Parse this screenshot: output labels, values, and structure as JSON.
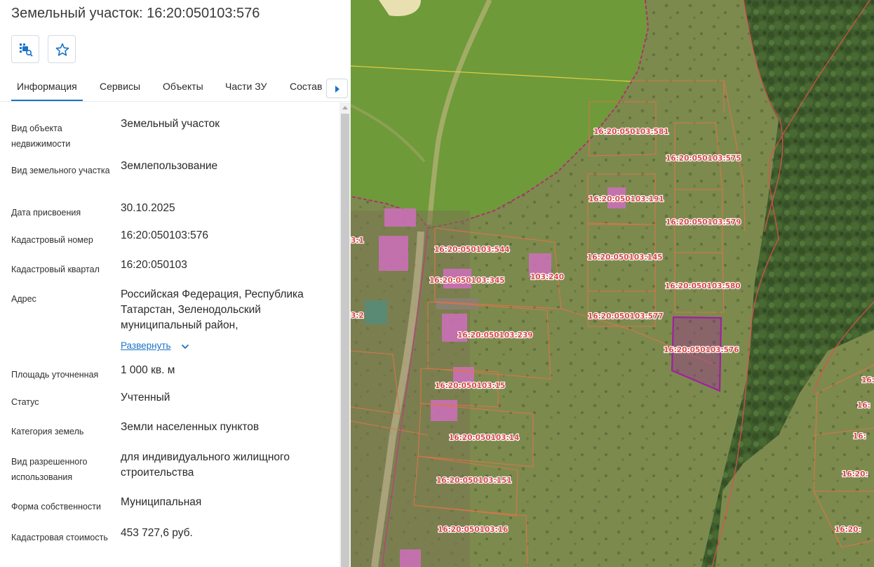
{
  "header": {
    "title": "Земельный участок: 16:20:050103:576",
    "buttons": [
      {
        "icon": "map-search-icon"
      },
      {
        "icon": "star-icon"
      }
    ]
  },
  "tabs": {
    "items": [
      "Информация",
      "Сервисы",
      "Объекты",
      "Части ЗУ",
      "Состав"
    ],
    "active": "Информация"
  },
  "info": {
    "object_type_label": "Вид объекта недвижимости",
    "object_type_value": "Земельный участок",
    "land_type_label": "Вид земельного участка",
    "land_type_value": "Землепользование",
    "assign_date_label": "Дата присвоения",
    "assign_date_value": "30.10.2025",
    "cadastral_number_label": "Кадастровый номер",
    "cadastral_number_value": "16:20:050103:576",
    "cadastral_block_label": "Кадастровый квартал",
    "cadastral_block_value": "16:20:050103",
    "address_label": "Адрес",
    "address_value": "Российская Федерация, Республика Татарстан, Зеленодольский муниципальный район,",
    "expand_label": "Развернуть",
    "area_label": "Площадь уточненная",
    "area_value": "1 000 кв. м",
    "status_label": "Статус",
    "status_value": "Учтенный",
    "category_label": "Категория земель",
    "category_value": "Земли населенных пунктов",
    "permitted_use_label": "Вид разрешенного использования",
    "permitted_use_value": "для индивидуального жилищного строительства",
    "ownership_label": "Форма собственности",
    "ownership_value": "Муниципальная",
    "cadastral_value_label": "Кадастровая стоимость",
    "cadastral_value_value": "453 727,6 руб."
  },
  "map": {
    "labels": {
      "l581": "16:20:050103:581",
      "l575": "16:20:050103:575",
      "l191": "16:20:050103:191",
      "l579": "16:20:050103:579",
      "l544": "16:20:050103:544",
      "l145": "16:20:050103:145",
      "l240": "103:240",
      "l345": "16:20:050103:345",
      "l580": "16:20:050103:580",
      "l577": "16:20:050103:577",
      "l239": "16:20:050103:239",
      "l576": "16:20:050103:576",
      "l15": "16:20:050103:15",
      "l14": "16:20:050103:14",
      "l151": "16:20:050103:151",
      "l16": "16:20:050103:16",
      "e1": "3:1",
      "e2": "3:2",
      "r1": "16:",
      "r2": "16:",
      "r3": "16:",
      "r4": "16:20:",
      "r5": "16:20:"
    },
    "colors": {
      "parcel_border": "#e0744a",
      "selected_parcel": "#a020a0",
      "building": "#d070c0",
      "meadow": "#7a9a4a",
      "field": "#6f9838",
      "forest": "#3f5d2c"
    }
  }
}
